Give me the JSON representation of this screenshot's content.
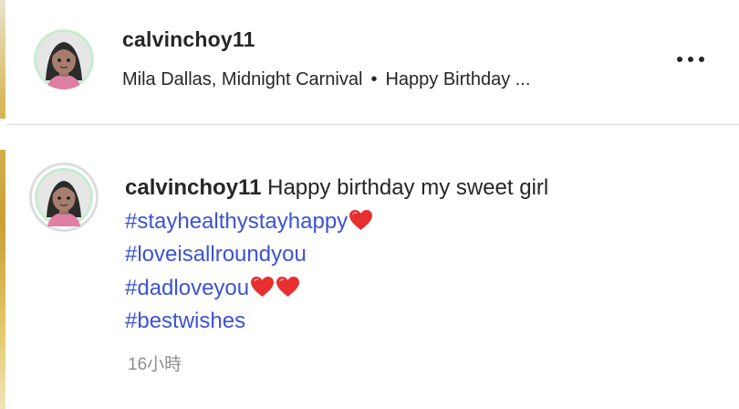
{
  "post": {
    "username": "calvinchoy11",
    "music": "Mila Dallas, Midnight Carnival",
    "separator": "•",
    "caption_preview": "Happy Birthday ..."
  },
  "comment": {
    "author": "calvinchoy11",
    "text": "Happy birthday my sweet girl",
    "hashtags": [
      "#stayhealthystayhappy",
      "#loveisallroundyou",
      "#dadloveyou",
      "#bestwishes"
    ],
    "timestamp": "16小時"
  },
  "icons": {
    "more": "more-options-icon",
    "heart": "red-heart-emoji",
    "avatar": "girl-emoji-avatar"
  },
  "colors": {
    "hashtag": "#3c52d8",
    "heart": "#e5302f",
    "avatar_ring": "#c7ebd2"
  }
}
